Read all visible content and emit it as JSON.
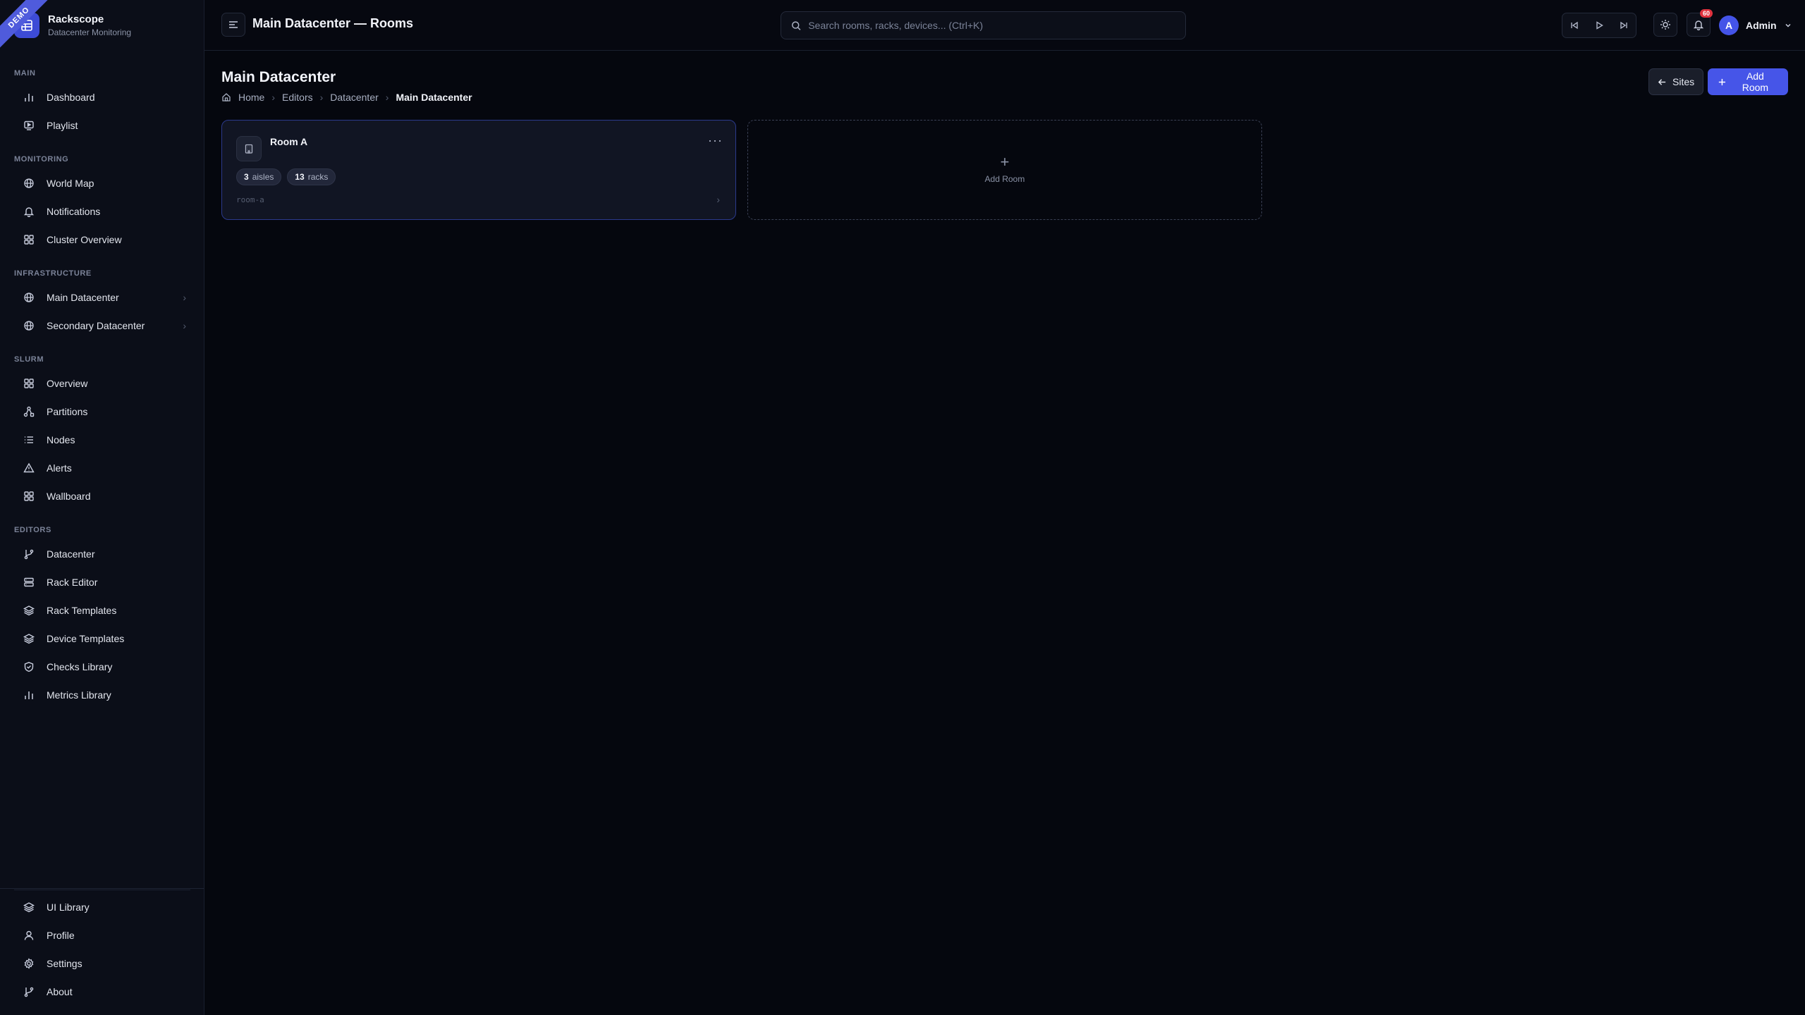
{
  "brand": {
    "ribbon": "DEMO",
    "name": "Rackscope",
    "subtitle": "Datacenter Monitoring"
  },
  "sidebar": {
    "sections": [
      {
        "title": "MAIN",
        "items": [
          {
            "label": "Dashboard",
            "icon": "bar-chart-icon"
          },
          {
            "label": "Playlist",
            "icon": "playlist-icon"
          }
        ]
      },
      {
        "title": "MONITORING",
        "items": [
          {
            "label": "World Map",
            "icon": "globe-icon"
          },
          {
            "label": "Notifications",
            "icon": "bell-icon"
          },
          {
            "label": "Cluster Overview",
            "icon": "grid-icon"
          }
        ]
      },
      {
        "title": "INFRASTRUCTURE",
        "items": [
          {
            "label": "Main Datacenter",
            "icon": "globe-icon",
            "expandable": true
          },
          {
            "label": "Secondary Datacenter",
            "icon": "globe-icon",
            "expandable": true
          }
        ]
      },
      {
        "title": "SLURM",
        "items": [
          {
            "label": "Overview",
            "icon": "grid-icon"
          },
          {
            "label": "Partitions",
            "icon": "network-icon"
          },
          {
            "label": "Nodes",
            "icon": "list-icon"
          },
          {
            "label": "Alerts",
            "icon": "warning-icon"
          },
          {
            "label": "Wallboard",
            "icon": "grid-icon"
          }
        ]
      },
      {
        "title": "EDITORS",
        "items": [
          {
            "label": "Datacenter",
            "icon": "git-branch-icon"
          },
          {
            "label": "Rack Editor",
            "icon": "server-icon"
          },
          {
            "label": "Rack Templates",
            "icon": "layers-icon"
          },
          {
            "label": "Device Templates",
            "icon": "layers-icon"
          },
          {
            "label": "Checks Library",
            "icon": "shield-check-icon"
          },
          {
            "label": "Metrics Library",
            "icon": "bar-chart-icon"
          }
        ]
      }
    ],
    "bottom": [
      {
        "label": "UI Library",
        "icon": "layers-icon"
      },
      {
        "label": "Profile",
        "icon": "user-icon"
      },
      {
        "label": "Settings",
        "icon": "gear-icon"
      },
      {
        "label": "About",
        "icon": "git-branch-icon"
      }
    ]
  },
  "topbar": {
    "title": "Main Datacenter — Rooms",
    "search_placeholder": "Search rooms, racks, devices... (Ctrl+K)",
    "notification_count": "60",
    "user_initial": "A",
    "user_name": "Admin"
  },
  "page": {
    "title": "Main Datacenter",
    "breadcrumb": [
      "Home",
      "Editors",
      "Datacenter",
      "Main Datacenter"
    ],
    "sites_label": "Sites",
    "add_room_label": "Add Room"
  },
  "rooms": [
    {
      "name": "Room A",
      "aisles": "3",
      "aisles_label": "aisles",
      "racks": "13",
      "racks_label": "racks",
      "slug": "room-a"
    }
  ],
  "add_card_label": "Add Room",
  "colors": {
    "accent": "#4655e8",
    "background": "#05070e",
    "sidebar": "#0b0e18",
    "badge": "#e0323e"
  }
}
